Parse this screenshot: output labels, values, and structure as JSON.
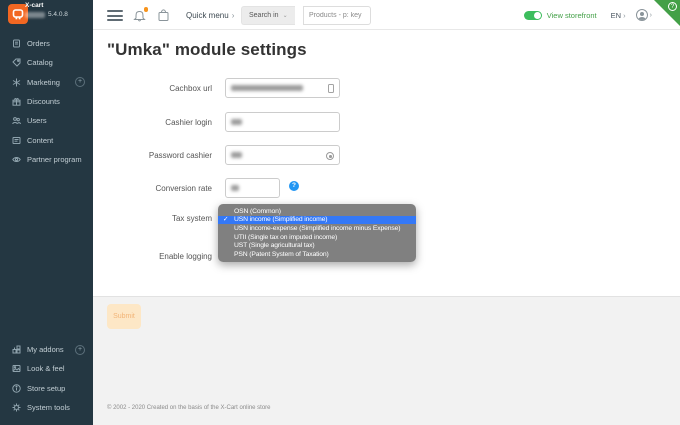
{
  "colors": {
    "brand_orange": "#f26722",
    "highlight_blue": "#3478f6",
    "green": "#43a047",
    "help_blue": "#2196f3",
    "sidebar_bg": "#243742"
  },
  "app": {
    "brand": "X-cart",
    "version": "5.4.0.8"
  },
  "icons": {
    "checkmark": "✓",
    "chevron_right": "›",
    "chevron_down": "⌄",
    "plus": "+",
    "question": "?"
  },
  "sidebar": {
    "items": [
      {
        "label": "Orders"
      },
      {
        "label": "Catalog"
      },
      {
        "label": "Marketing",
        "has_add": true
      },
      {
        "label": "Discounts"
      },
      {
        "label": "Users"
      },
      {
        "label": "Content"
      },
      {
        "label": "Partner program"
      }
    ],
    "bottom_items": [
      {
        "label": "My addons",
        "has_add": true
      },
      {
        "label": "Look & feel"
      },
      {
        "label": "Store setup"
      },
      {
        "label": "System tools"
      }
    ]
  },
  "header": {
    "quick_menu_label": "Quick menu",
    "search_in_label": "Search in",
    "search_value": "Products - p: key",
    "view_storefront_label": "View storefront",
    "language_label": "EN"
  },
  "page": {
    "title": "\"Umka\" module settings",
    "fields": [
      {
        "label": "Cachbox url",
        "value_blurred": true
      },
      {
        "label": "Cashier login",
        "value_blurred": true
      },
      {
        "label": "Password cashier",
        "value_blurred": true
      },
      {
        "label": "Conversion rate",
        "value_blurred": true
      },
      {
        "label": "Tax system"
      },
      {
        "label": "Enable logging"
      }
    ],
    "submit_label": "Submit",
    "footer": "© 2002 - 2020 Created on the basis of the X-Cart online store"
  },
  "tax_dropdown": {
    "selected_index": 1,
    "options": [
      "OSN (Common)",
      "USN income (Simplified income)",
      "USN income-expense (Simplified income minus Expense)",
      "UTII (Single tax on imputed income)",
      "UST (Single agricultural tax)",
      "PSN (Patent System of Taxation)"
    ]
  }
}
